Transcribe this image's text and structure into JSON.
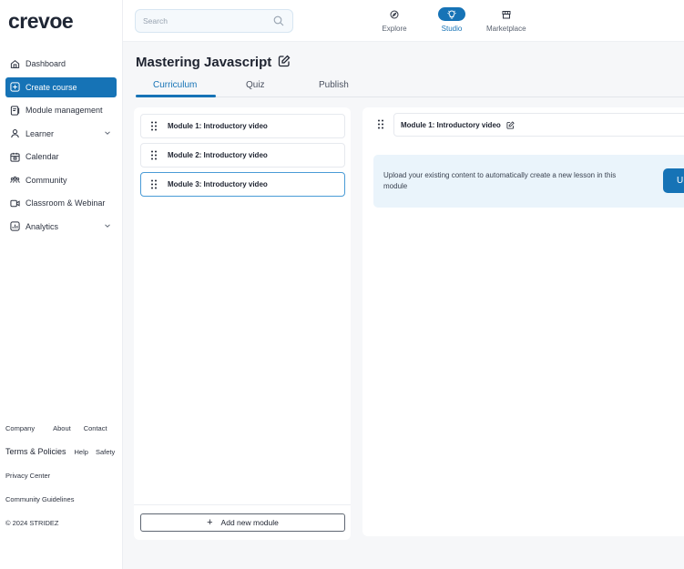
{
  "brand": {
    "logo_text": "crevoe"
  },
  "sidebar": {
    "items": [
      {
        "label": "Dashboard",
        "icon": "home-icon"
      },
      {
        "label": "Create course",
        "icon": "plus-square-icon",
        "active": true
      },
      {
        "label": "Module management",
        "icon": "module-icon"
      },
      {
        "label": "Learner",
        "icon": "user-icon",
        "expandable": true
      },
      {
        "label": "Calendar",
        "icon": "calendar-icon"
      },
      {
        "label": "Community",
        "icon": "community-icon"
      },
      {
        "label": "Classroom & Webinar",
        "icon": "video-icon"
      },
      {
        "label": "Analytics",
        "icon": "analytics-icon",
        "expandable": true
      }
    ],
    "footer": {
      "company": "Company",
      "about": "About",
      "contact": "Contact",
      "terms": "Terms & Policies",
      "help": "Help",
      "safety": "Safety",
      "privacy": "Privacy Center",
      "guidelines": "Community Guidelines",
      "copyright": "© 2024 STRIDEZ"
    }
  },
  "topbar": {
    "search_placeholder": "Search",
    "nav": [
      {
        "label": "Explore",
        "icon": "compass-icon"
      },
      {
        "label": "Studio",
        "icon": "bulb-icon",
        "active": true
      },
      {
        "label": "Marketplace",
        "icon": "store-icon"
      }
    ]
  },
  "course": {
    "title": "Mastering Javascript",
    "tabs": [
      {
        "label": "Curriculum",
        "active": true
      },
      {
        "label": "Quiz"
      },
      {
        "label": "Publish"
      }
    ]
  },
  "modules": [
    {
      "label": "Module 1: Introductory video"
    },
    {
      "label": "Module 2: Introductory video"
    },
    {
      "label": "Module 3: Introductory video",
      "selected": true
    }
  ],
  "add_module_label": "Add new module",
  "detail": {
    "module_name": "Module 1: Introductory video",
    "upload_text": "Upload your existing content to automatically create a new lesson in this module",
    "upload_button": "U"
  },
  "colors": {
    "accent": "#1673b6",
    "panel_bg": "#eaf4fb"
  }
}
